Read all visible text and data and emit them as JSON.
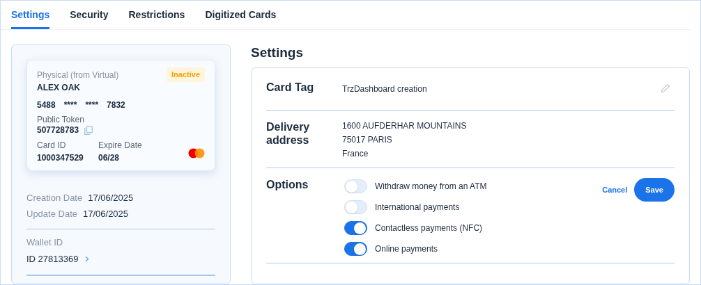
{
  "tabs": [
    {
      "label": "Settings",
      "selected": true
    },
    {
      "label": "Security",
      "selected": false
    },
    {
      "label": "Restrictions",
      "selected": false
    },
    {
      "label": "Digitized Cards",
      "selected": false
    }
  ],
  "card": {
    "type": "Physical (from Virtual)",
    "status": "Inactive",
    "holder": "ALEX OAK",
    "number": [
      "5488",
      "****",
      "****",
      "7832"
    ],
    "token_label": "Public Token",
    "token": "507728783",
    "card_id_label": "Card ID",
    "card_id": "1000347529",
    "expire_label": "Expire Date",
    "expire": "06/28"
  },
  "dates": [
    {
      "label": "Creation Date",
      "value": "17/06/2025"
    },
    {
      "label": "Update Date",
      "value": "17/06/2025"
    }
  ],
  "wallet": {
    "label": "Wallet ID",
    "value": "ID 27813369"
  },
  "settings": {
    "title": "Settings",
    "card_tag_label": "Card Tag",
    "card_tag": "TrzDashboard creation",
    "address_label": "Delivery address",
    "address": [
      "1600 AUFDERHAR MOUNTAINS",
      "75017 PARIS",
      "France"
    ],
    "options_label": "Options",
    "options": [
      {
        "label": "Withdraw money from an ATM",
        "on": false
      },
      {
        "label": "International payments",
        "on": false
      },
      {
        "label": "Contactless payments (NFC)",
        "on": true
      },
      {
        "label": "Online payments",
        "on": true
      }
    ],
    "cancel": "Cancel",
    "save": "Save"
  }
}
